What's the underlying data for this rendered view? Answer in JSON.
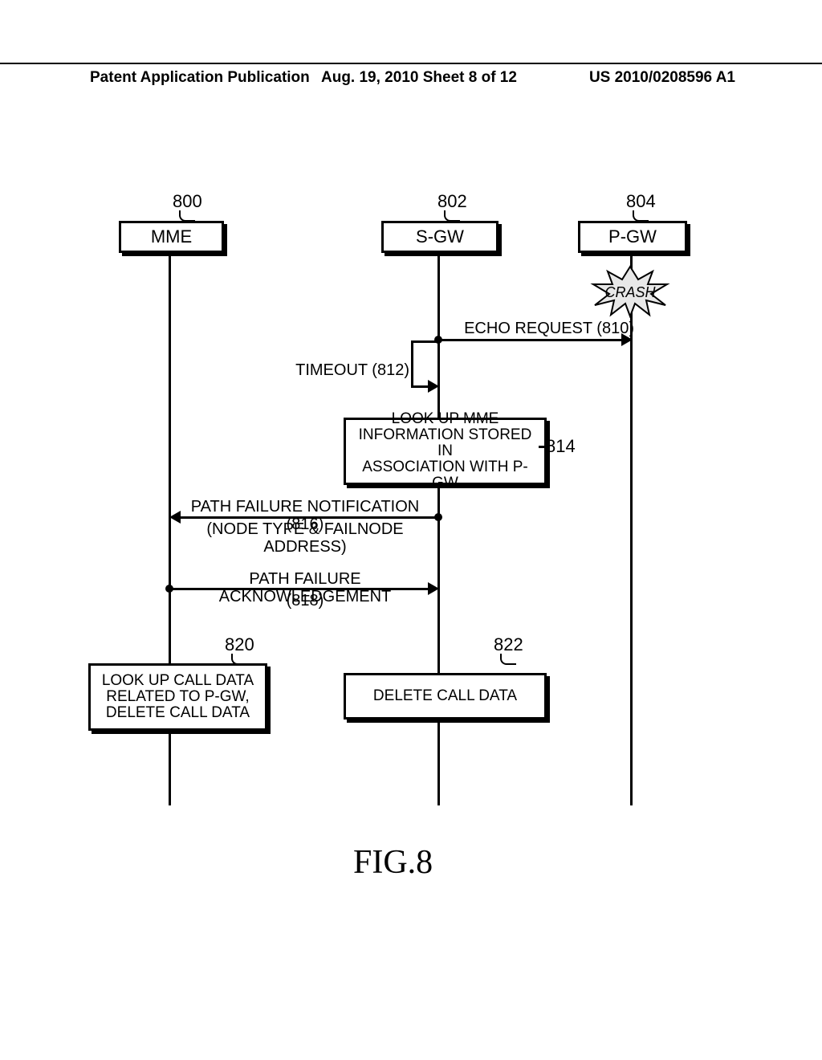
{
  "header": {
    "pub_type": "Patent Application Publication",
    "date_sheet": "Aug. 19, 2010  Sheet 8 of 12",
    "pub_no": "US 2010/0208596 A1"
  },
  "nodes": {
    "mme": {
      "ref": "800",
      "label": "MME"
    },
    "sgw": {
      "ref": "802",
      "label": "S-GW"
    },
    "pgw": {
      "ref": "804",
      "label": "P-GW"
    }
  },
  "crash": "CRASH",
  "messages": {
    "echo": "ECHO REQUEST (810)",
    "timeout": "TIMEOUT (812)",
    "lookup_mme_ref": "814",
    "lookup_mme": "LOOK UP MME\nINFORMATION STORED IN\nASSOCIATION WITH P-GW",
    "pfn_line1": "PATH FAILURE NOTIFICATION (816)",
    "pfn_line2": "(NODE TYPE & FAILNODE ADDRESS)",
    "pfa_line1": "PATH FAILURE ACKNOWLEDGEMENT",
    "pfa_line2": "(818)"
  },
  "actions": {
    "mme_ref": "820",
    "mme_box": "LOOK UP CALL DATA\nRELATED TO P-GW,\nDELETE CALL DATA",
    "sgw_ref": "822",
    "sgw_box": "DELETE CALL DATA"
  },
  "figure": "FIG.8",
  "chart_data": {
    "type": "sequence-diagram",
    "participants": [
      "MME (800)",
      "S-GW (802)",
      "P-GW (804)"
    ],
    "events": [
      {
        "at": "P-GW",
        "event": "CRASH"
      },
      {
        "from": "S-GW",
        "to": "P-GW",
        "label": "ECHO REQUEST (810)"
      },
      {
        "from": "S-GW",
        "to": "S-GW",
        "label": "TIMEOUT (812)"
      },
      {
        "at": "S-GW",
        "event": "LOOK UP MME INFORMATION STORED IN ASSOCIATION WITH P-GW (814)"
      },
      {
        "from": "S-GW",
        "to": "MME",
        "label": "PATH FAILURE NOTIFICATION (816) (NODE TYPE & FAILNODE ADDRESS)"
      },
      {
        "from": "MME",
        "to": "S-GW",
        "label": "PATH FAILURE ACKNOWLEDGEMENT (818)"
      },
      {
        "at": "MME",
        "event": "LOOK UP CALL DATA RELATED TO P-GW, DELETE CALL DATA (820)"
      },
      {
        "at": "S-GW",
        "event": "DELETE CALL DATA (822)"
      }
    ]
  }
}
